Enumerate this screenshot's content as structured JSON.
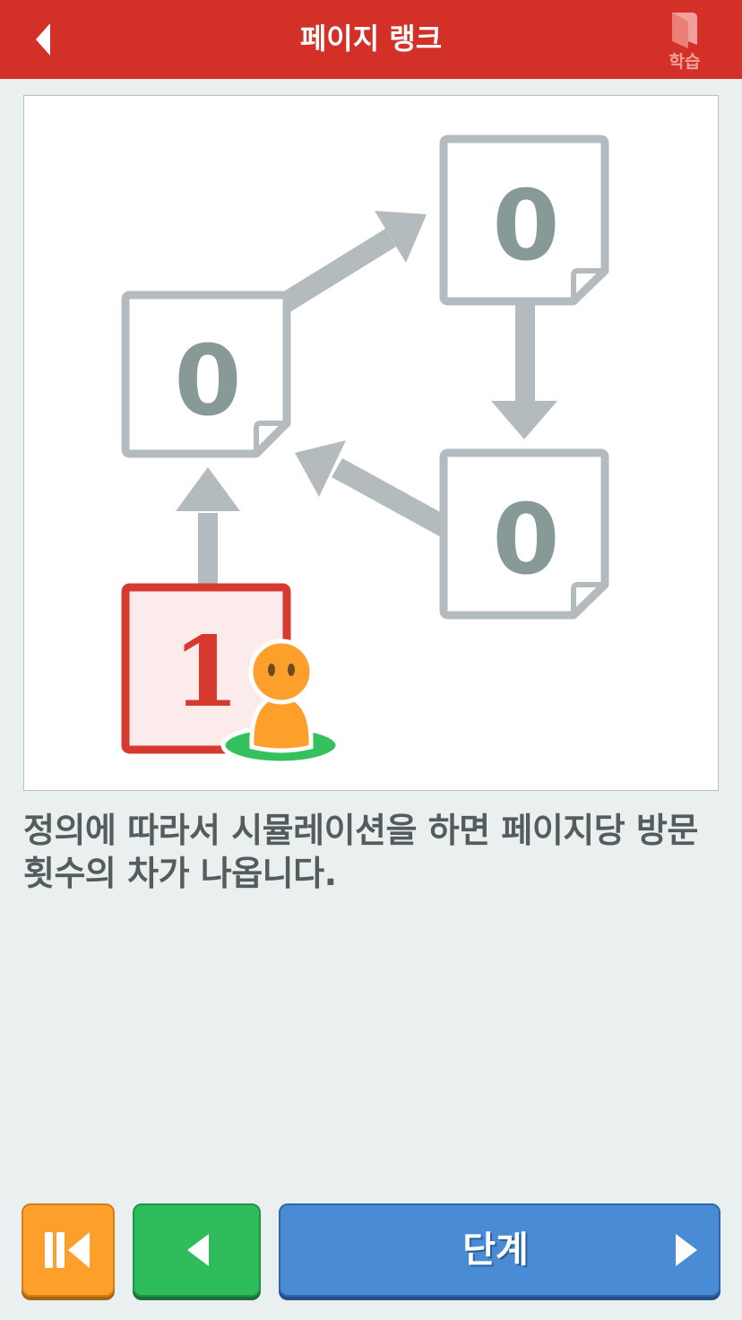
{
  "header": {
    "title": "페이지 랭크",
    "learn_label": "학습",
    "back_icon": "chevron-left-icon",
    "learn_icon": "book-icon",
    "bg_color": "#d33127"
  },
  "figure": {
    "pages": [
      {
        "id": "page-left",
        "value": "0",
        "highlighted": false
      },
      {
        "id": "page-top-right",
        "value": "0",
        "highlighted": false
      },
      {
        "id": "page-bottom-right",
        "value": "0",
        "highlighted": false
      },
      {
        "id": "page-start",
        "value": "1",
        "highlighted": true
      }
    ],
    "links": [
      {
        "from": "page-start",
        "to": "page-left"
      },
      {
        "from": "page-left",
        "to": "page-top-right"
      },
      {
        "from": "page-top-right",
        "to": "page-bottom-right"
      },
      {
        "from": "page-bottom-right",
        "to": "page-left"
      }
    ],
    "visitor": "person-icon",
    "colors": {
      "page": "#b4bbbf",
      "digit": "#879a98",
      "highlight": "#d63a2f",
      "visitor": "#fd9f2b",
      "ground": "#33c05d"
    }
  },
  "caption": "정의에 따라서 시뮬레이션을 하면 페이지당 방문 횟수의 차가 나옵니다.",
  "controls": {
    "first_icon": "skip-to-start-icon",
    "prev_icon": "play-left-icon",
    "next_label": "단계",
    "next_icon": "play-right-icon",
    "colors": {
      "first": "#fd9f2b",
      "prev": "#2fbd5b",
      "next": "#4a8bd6"
    }
  }
}
